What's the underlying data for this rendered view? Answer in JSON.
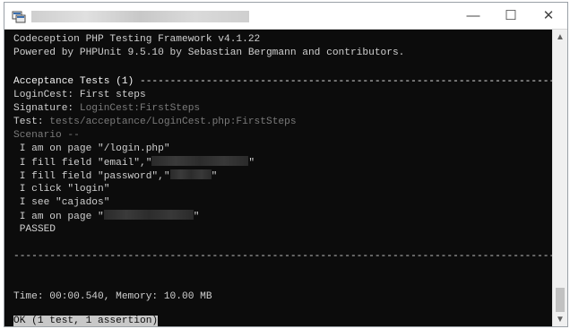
{
  "window": {
    "controls": {
      "minimize": "—",
      "maximize": "☐",
      "close": "✕"
    },
    "icons": {
      "app": "console-app-icon",
      "scroll_up": "scroll-up-arrow-icon",
      "scroll_down": "scroll-down-arrow-icon"
    }
  },
  "console": {
    "header1": "Codeception PHP Testing Framework v4.1.22",
    "header2": "Powered by PHPUnit 9.5.10 by Sebastian Bergmann and contributors.",
    "suite_label": "Acceptance Tests (1) ",
    "suite_rule": "----------------------------------------------------------------------------",
    "test_name": "LoginCest: First steps",
    "signature_label": "Signature: ",
    "signature_value": "LoginCest:FirstSteps",
    "test_label": "Test: ",
    "test_value": "tests/acceptance/LoginCest.php:FirstSteps",
    "scenario_label": "Scenario --",
    "steps": {
      "s1": " I am on page \"/login.php\"",
      "s2a": " I fill field \"email\",\"",
      "s2b": "\"",
      "s3a": " I fill field \"password\",\"",
      "s3b": "\"",
      "s4": " I click \"login\"",
      "s5": " I see \"cajados\"",
      "s6a": " I am on page \"",
      "s6b": "\""
    },
    "status": " PASSED",
    "footer_rule": "---------------------------------------------------------------------------------------------",
    "time_line": "Time: 00:00.540, Memory: 10.00 MB",
    "result_line": "OK (1 test, 1 assertion)"
  },
  "colors": {
    "terminal_bg": "#0c0c0c",
    "text": "#d0d0d0",
    "dim_text": "#7a7a7a",
    "highlight_bg": "#c8c8c8"
  }
}
